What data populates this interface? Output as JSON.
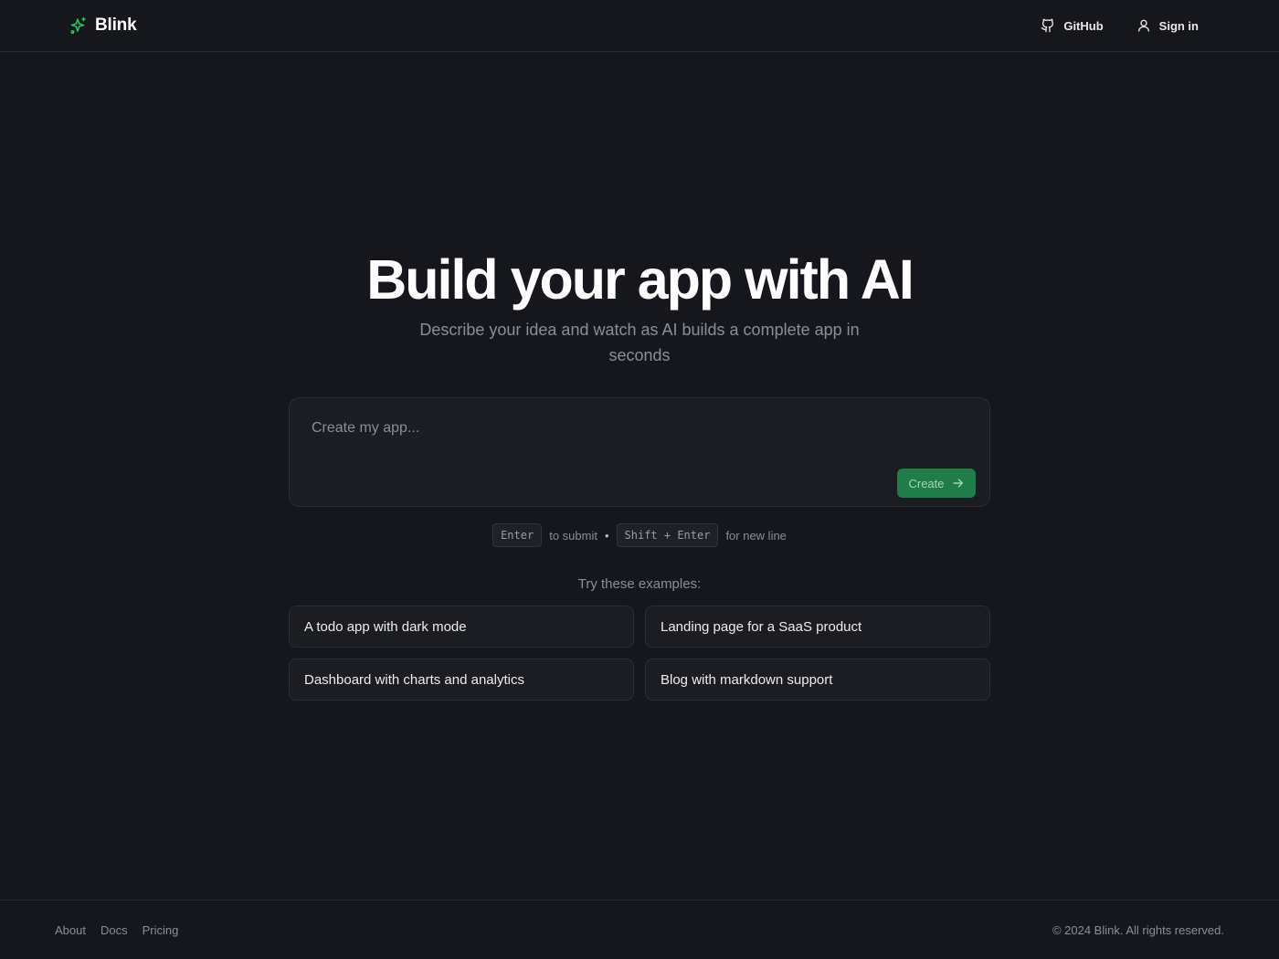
{
  "header": {
    "brand_name": "Blink",
    "brand_icon": "sparkles-icon",
    "github_label": "GitHub",
    "github_icon": "github-icon",
    "signin_label": "Sign in",
    "signin_icon": "user-icon"
  },
  "hero": {
    "title": "Build your app with AI",
    "subtitle": "Describe your idea and watch as AI builds a complete app in seconds"
  },
  "prompt": {
    "placeholder": "Create my app...",
    "value": "",
    "create_label": "Create",
    "create_icon": "arrow-right-icon"
  },
  "hint": {
    "key_enter": "Enter",
    "submit_text": "to submit",
    "separator": "•",
    "key_shift_enter": "Shift + Enter",
    "newline_text": "for new line"
  },
  "examples": {
    "title": "Try these examples:",
    "items": [
      {
        "label": "A todo app with dark mode"
      },
      {
        "label": "Landing page for a SaaS product"
      },
      {
        "label": "Dashboard with charts and analytics"
      },
      {
        "label": "Blog with markdown support"
      }
    ]
  },
  "footer": {
    "links": [
      "About",
      "Docs",
      "Pricing"
    ],
    "copyright": "© 2024 Blink. All rights reserved."
  },
  "colors": {
    "background": "#15171c",
    "accent": "#22c55e",
    "create_button": "#1f7d49"
  }
}
